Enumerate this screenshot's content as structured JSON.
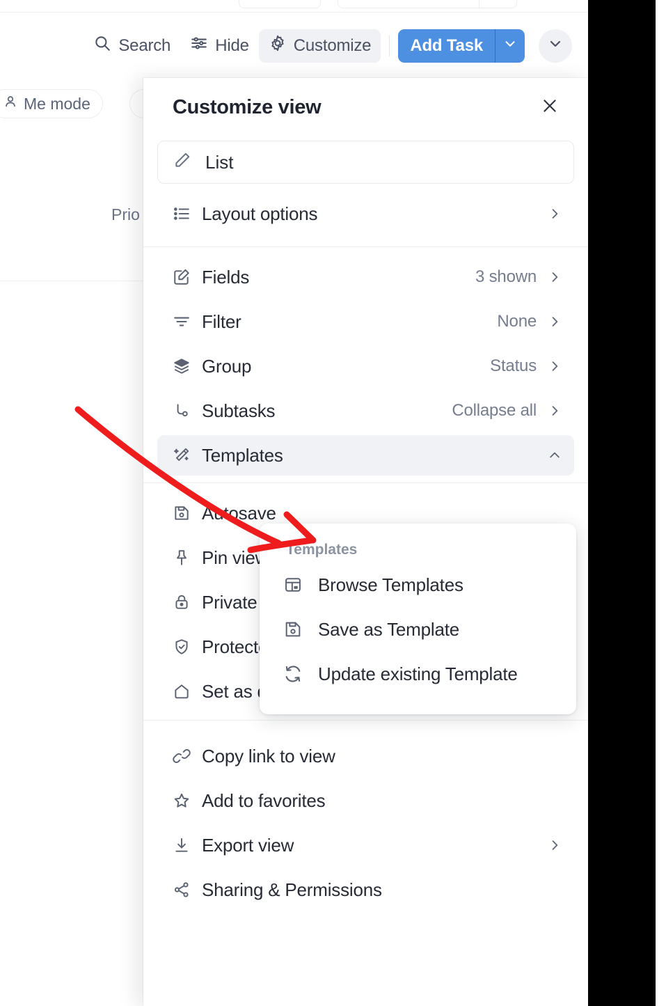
{
  "toolbar": {
    "search_label": "Search",
    "search_icon": "search-icon",
    "hide_label": "Hide",
    "hide_icon": "sliders-icon",
    "customize_label": "Customize",
    "customize_icon": "gear-icon",
    "add_task_label": "Add Task",
    "add_task_caret_icon": "chevron-down-icon",
    "more_caret_icon": "chevron-down-icon",
    "accent_color": "#4d90e2",
    "active_chip_bg": "#f0f1f4"
  },
  "background": {
    "chips": [
      {
        "label": "Me mode",
        "icon": "person-icon"
      },
      {
        "label": "",
        "icon": "person-icon"
      }
    ],
    "column_header": "Prio"
  },
  "panel": {
    "title": "Customize view",
    "close_icon": "close-icon",
    "view_row": {
      "label": "List",
      "icon": "pencil-icon"
    },
    "layout_row": {
      "label": "Layout options",
      "icon": "list-icon",
      "chevron": "chevron-right-icon"
    },
    "settings": [
      {
        "label": "Fields",
        "icon": "edit-square-icon",
        "value": "3 shown",
        "chevron": "chevron-right-icon"
      },
      {
        "label": "Filter",
        "icon": "filter-icon",
        "value": "None",
        "chevron": "chevron-right-icon"
      },
      {
        "label": "Group",
        "icon": "layers-icon",
        "value": "Status",
        "chevron": "chevron-right-icon"
      },
      {
        "label": "Subtasks",
        "icon": "subtask-icon",
        "value": "Collapse all",
        "chevron": "chevron-right-icon"
      },
      {
        "label": "Templates",
        "icon": "magic-wand-icon",
        "value": "",
        "chevron": "chevron-up-icon",
        "highlighted": true
      }
    ],
    "options": [
      {
        "label": "Autosave",
        "icon": "floppy-disk-icon"
      },
      {
        "label": "Pin view",
        "icon": "pin-icon"
      },
      {
        "label": "Private",
        "icon": "lock-icon"
      },
      {
        "label": "Protected",
        "icon": "shield-check-icon"
      },
      {
        "label": "Set as default view",
        "icon": "home-icon",
        "toggle": "off"
      }
    ],
    "actions": [
      {
        "label": "Copy link to view",
        "icon": "link-icon"
      },
      {
        "label": "Add to favorites",
        "icon": "star-icon"
      },
      {
        "label": "Export view",
        "icon": "download-icon",
        "chevron": "chevron-right-icon"
      },
      {
        "label": "Sharing & Permissions",
        "icon": "share-icon"
      }
    ]
  },
  "submenu": {
    "heading": "Templates",
    "items": [
      {
        "label": "Browse Templates",
        "icon": "browse-template-icon"
      },
      {
        "label": "Save as Template",
        "icon": "floppy-disk-icon"
      },
      {
        "label": "Update existing Template",
        "icon": "refresh-icon"
      }
    ]
  },
  "annotation": {
    "arrow_color": "#ee1c1c",
    "arrow_target": "templates-submenu"
  }
}
